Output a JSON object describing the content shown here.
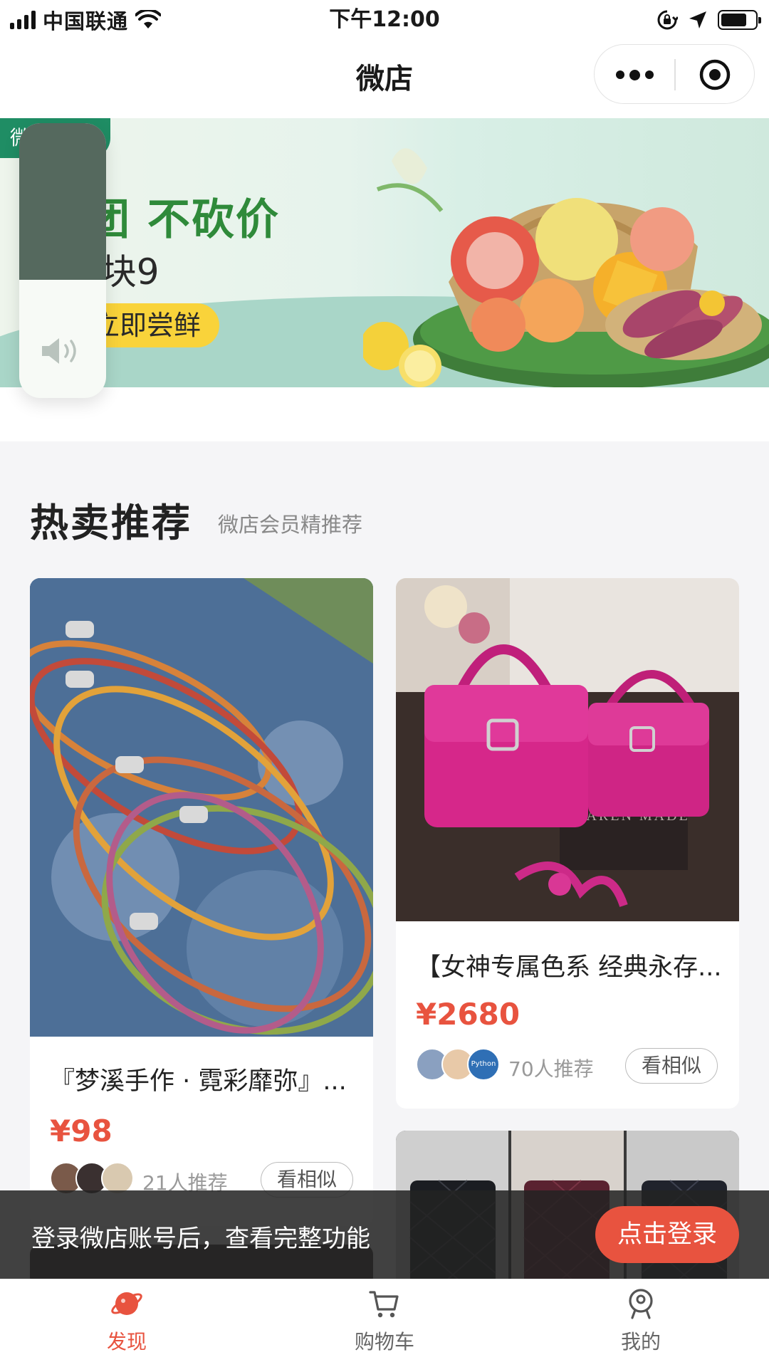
{
  "status_bar": {
    "carrier": "中国联通",
    "time": "下午12:00",
    "battery_level": 0.8
  },
  "nav": {
    "title": "微店",
    "more_icon": "ellipsis-icon",
    "close_icon": "target-icon"
  },
  "banner": {
    "tag": "微店·生鲜",
    "line1": "拼团 不砍价",
    "line2": "场9块9",
    "cta": "立即尝鲜"
  },
  "section": {
    "title": "热卖推荐",
    "subtitle": "微店会员精推荐"
  },
  "products": [
    {
      "title": "『梦溪手作 · 霓彩靡弥』...",
      "price": "¥98",
      "recommend": "21人推荐",
      "similar": "看相似"
    },
    {
      "title": "【女神专属色系 经典永存...",
      "price": "¥2680",
      "recommend": "70人推荐",
      "similar": "看相似"
    }
  ],
  "product_image_text": {
    "brand": "KAREN MADE",
    "avatar": "Python"
  },
  "login_prompt": {
    "text": "登录微店账号后，查看完整功能",
    "button": "点击登录"
  },
  "tabbar": [
    {
      "label": "发现",
      "icon": "planet-icon",
      "active": true
    },
    {
      "label": "购物车",
      "icon": "cart-icon",
      "active": false
    },
    {
      "label": "我的",
      "icon": "profile-icon",
      "active": false
    }
  ],
  "colors": {
    "accent": "#e8533f",
    "banner_tag": "#1f8d64",
    "banner_text": "#2f8a3a"
  }
}
